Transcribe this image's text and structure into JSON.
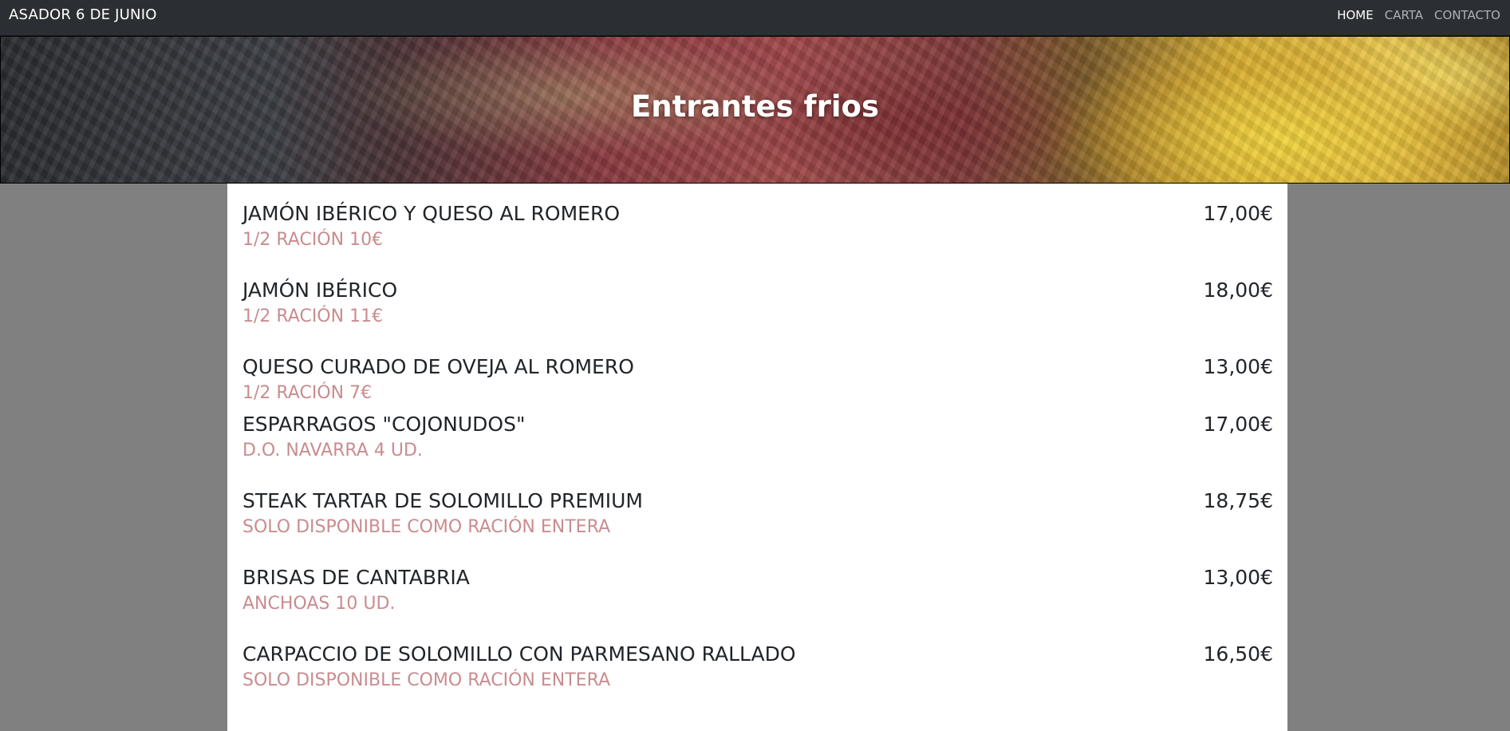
{
  "navbar": {
    "brand": "ASADOR 6 DE JUNIO",
    "links": [
      {
        "label": "HOME"
      },
      {
        "label": "CARTA"
      },
      {
        "label": "CONTACTO"
      }
    ]
  },
  "hero": {
    "title": "Entrantes frios"
  },
  "menu": {
    "items": [
      {
        "name": "JAMÓN IBÉRICO Y QUESO AL ROMERO",
        "price": "17,00€",
        "note": "1/2 RACIÓN 10€"
      },
      {
        "name": "JAMÓN IBÉRICO",
        "price": "18,00€",
        "note": "1/2 RACIÓN 11€"
      },
      {
        "name": "QUESO CURADO DE OVEJA AL ROMERO",
        "price": "13,00€",
        "note": "1/2 RACIÓN 7€"
      },
      {
        "name": "ESPARRAGOS \"COJONUDOS\"",
        "price": "17,00€",
        "note": "D.O. NAVARRA 4 UD."
      },
      {
        "name": "STEAK TARTAR DE SOLOMILLO PREMIUM",
        "price": "18,75€",
        "note": "SOLO DISPONIBLE COMO RACIÓN ENTERA"
      },
      {
        "name": "BRISAS DE CANTABRIA",
        "price": "13,00€",
        "note": "ANCHOAS 10 UD."
      },
      {
        "name": "CARPACCIO DE SOLOMILLO CON PARMESANO RALLADO",
        "price": "16,50€",
        "note": "SOLO DISPONIBLE COMO RACIÓN ENTERA"
      }
    ]
  },
  "colors": {
    "navbar_bg": "#2b2f33",
    "page_bg": "#808080",
    "note_text": "#c98c8f"
  }
}
